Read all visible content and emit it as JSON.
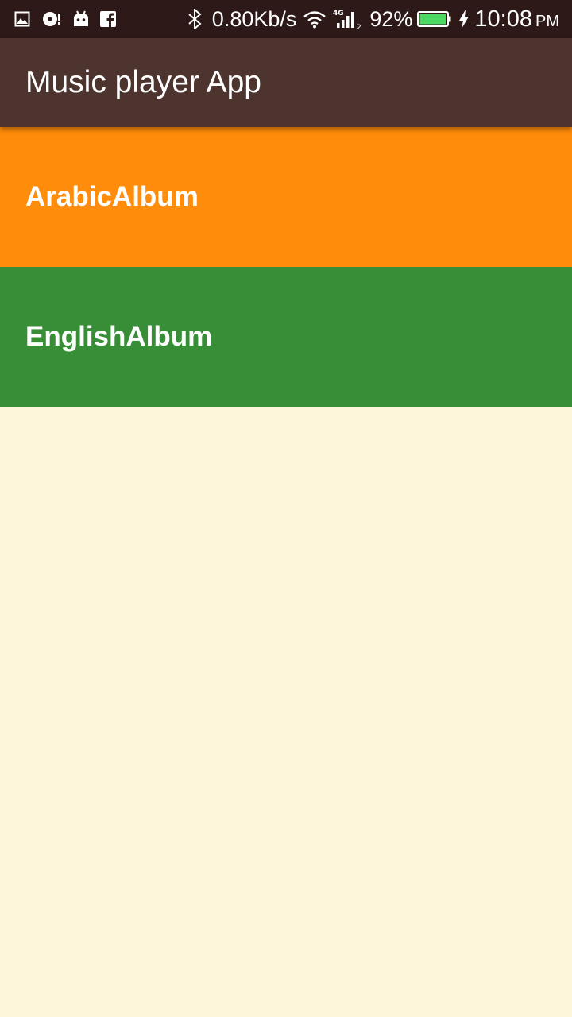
{
  "status_bar": {
    "left_icons": [
      "gallery-icon",
      "music-notification-icon",
      "android-icon",
      "facebook-icon"
    ],
    "right_icons": [
      "bluetooth-icon",
      "wifi-icon",
      "signal-4g-icon",
      "battery-icon",
      "charging-icon"
    ],
    "data_speed": "0.80Kb/s",
    "battery_percent": "92%",
    "time": "10:08",
    "ampm": "PM",
    "colors": {
      "background": "#2D1A18",
      "battery_fill": "#4CD964"
    }
  },
  "app_bar": {
    "title": "Music player App",
    "color": "#4E342E"
  },
  "albums": [
    {
      "label": "ArabicAlbum",
      "color": "#FF8C0A"
    },
    {
      "label": "EnglishAlbum",
      "color": "#388E36"
    }
  ],
  "background_color": "#FDF6DA"
}
